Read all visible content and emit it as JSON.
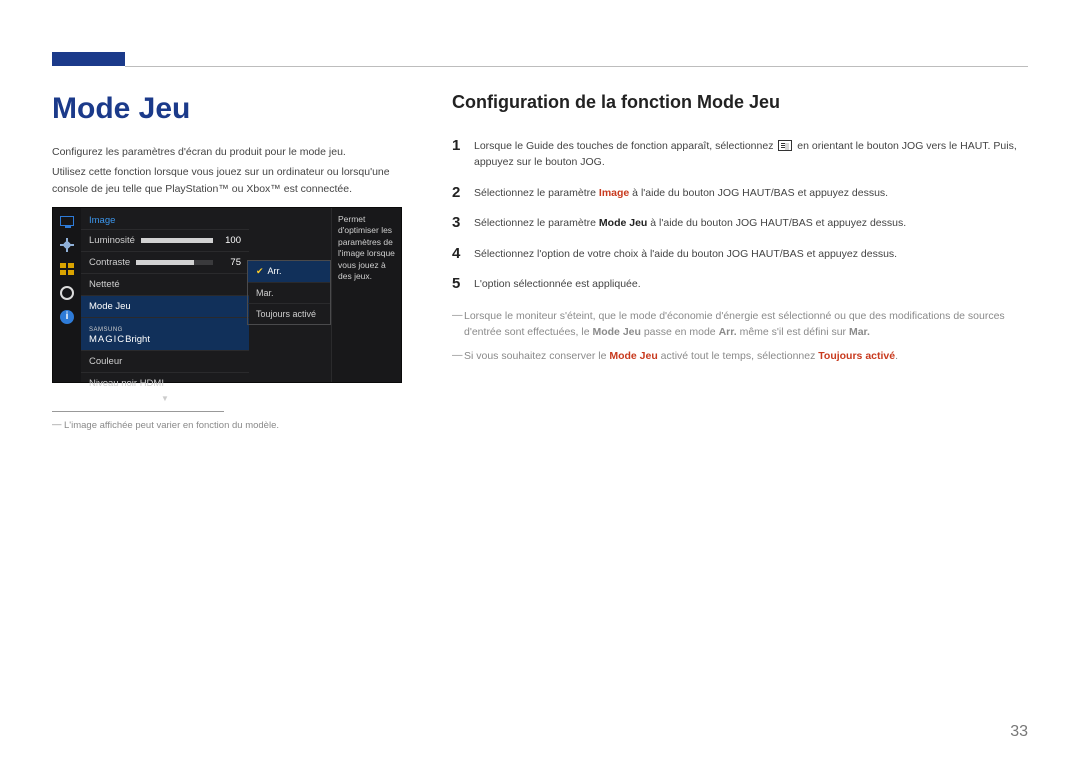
{
  "page_number": "33",
  "heading_left": "Mode Jeu",
  "left_desc_1": "Configurez les paramètres d'écran du produit pour le mode jeu.",
  "left_desc_2": "Utilisez cette fonction lorsque vous jouez sur un ordinateur ou lorsqu'une console de jeu telle que PlayStation™ ou Xbox™ est connectée.",
  "footnote": "L'image affichée peut varier en fonction du modèle.",
  "osd": {
    "title": "Image",
    "hint": "Permet d'optimiser les paramètres de l'image lorsque vous jouez à des jeux.",
    "rows": {
      "luminosite": {
        "label": "Luminosité",
        "value": "100",
        "pct": 100
      },
      "contraste": {
        "label": "Contraste",
        "value": "75",
        "pct": 75
      },
      "nettete": {
        "label": "Netteté"
      },
      "modejeu": {
        "label": "Mode Jeu"
      },
      "magic": {
        "prefix": "SAMSUNG",
        "suffix": "Bright",
        "label_full": "MAGIC"
      },
      "couleur": {
        "label": "Couleur"
      },
      "niveau": {
        "label": "Niveau noir HDMI"
      }
    },
    "popup": {
      "arr": "Arr.",
      "mar": "Mar.",
      "toujours": "Toujours activé"
    }
  },
  "heading_right": "Configuration de la fonction Mode Jeu",
  "steps": {
    "s1_a": "Lorsque le Guide des touches de fonction apparaît, sélectionnez",
    "s1_b": "en orientant le bouton JOG vers le HAUT. Puis, appuyez sur le bouton JOG.",
    "s2_a": "Sélectionnez le paramètre ",
    "s2_em": "Image",
    "s2_b": " à l'aide du bouton JOG HAUT/BAS et appuyez dessus.",
    "s3_a": "Sélectionnez le paramètre ",
    "s3_em": "Mode Jeu",
    "s3_b": " à l'aide du bouton JOG HAUT/BAS et appuyez dessus.",
    "s4": "Sélectionnez l'option de votre choix à l'aide du bouton JOG HAUT/BAS et appuyez dessus.",
    "s5": "L'option sélectionnée est appliquée."
  },
  "notes": {
    "n1_a": "Lorsque le moniteur s'éteint, que le mode d'économie d'énergie est sélectionné ou que des modifications de sources d'entrée sont effectuées, le ",
    "n1_m1": "Mode Jeu",
    "n1_b": " passe en mode ",
    "n1_m2": "Arr.",
    "n1_c": " même s'il est défini sur ",
    "n1_m3": "Mar.",
    "n2_a": "Si vous souhaitez conserver le ",
    "n2_m1": "Mode Jeu",
    "n2_b": " activé tout le temps, sélectionnez ",
    "n2_m2": "Toujours activé",
    "n2_c": "."
  }
}
